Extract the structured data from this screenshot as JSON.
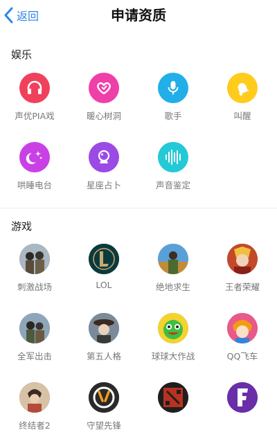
{
  "header": {
    "back_label": "返回",
    "title": "申请资质"
  },
  "sections": [
    {
      "title": "娱乐",
      "items": [
        {
          "label": "声优PIA戏",
          "icon": "headphones-icon",
          "color": "#f0415c"
        },
        {
          "label": "暖心树洞",
          "icon": "heart-icon",
          "color": "#ef3fa8"
        },
        {
          "label": "歌手",
          "icon": "microphone-icon",
          "color": "#22aee8"
        },
        {
          "label": "叫醒",
          "icon": "bell-icon",
          "color": "#ffcc1d"
        },
        {
          "label": "哄睡电台",
          "icon": "moon-stars-icon",
          "color": "#c941e6"
        },
        {
          "label": "星座占卜",
          "icon": "crystal-ball-icon",
          "color": "#9b4ae6"
        },
        {
          "label": "声音鉴定",
          "icon": "soundwave-icon",
          "color": "#23c9d6"
        }
      ]
    },
    {
      "title": "游戏",
      "items": [
        {
          "label": "刺激战场",
          "icon": "soldiers-game-icon",
          "color": "#8a6b4c"
        },
        {
          "label": "LOL",
          "icon": "lol-logo-icon",
          "color": "#0b3a3e"
        },
        {
          "label": "绝地求生",
          "icon": "pubg-game-icon",
          "color": "#c48b36"
        },
        {
          "label": "王者荣耀",
          "icon": "honor-of-kings-icon",
          "color": "#c24a2a"
        },
        {
          "label": "全军出击",
          "icon": "soldiers-game-icon",
          "color": "#5e7c9a"
        },
        {
          "label": "第五人格",
          "icon": "identity-v-icon",
          "color": "#4b5b6b"
        },
        {
          "label": "球球大作战",
          "icon": "ball-battle-icon",
          "color": "#3fbf3f"
        },
        {
          "label": "QQ飞车",
          "icon": "qq-speed-icon",
          "color": "#e85a8a"
        },
        {
          "label": "终结者2",
          "icon": "soldier-game-icon",
          "color": "#b34a3a"
        },
        {
          "label": "守望先锋",
          "icon": "overwatch-logo-icon",
          "color": "#2a2a2a"
        },
        {
          "label": "",
          "icon": "dota-logo-icon",
          "color": "#b8321f"
        },
        {
          "label": "",
          "icon": "fortnite-logo-icon",
          "color": "#6a2ea8"
        }
      ]
    }
  ]
}
